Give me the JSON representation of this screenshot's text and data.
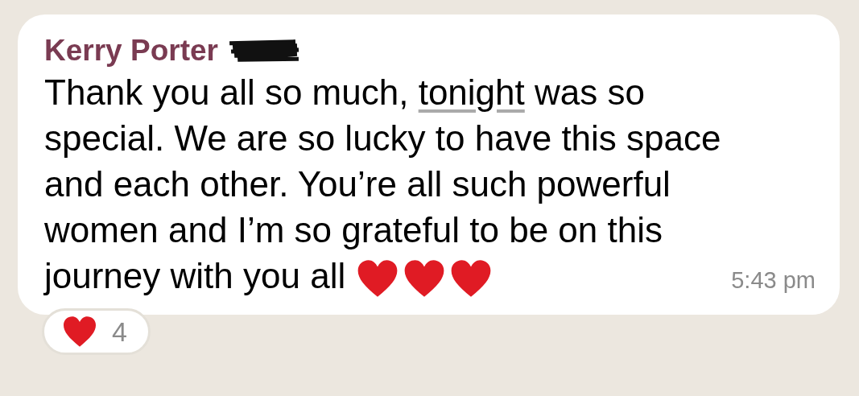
{
  "message": {
    "sender": "Kerry Porter",
    "sender_redacted": true,
    "text_before": "Thank you all so much, ",
    "link": "tonight",
    "text_after": " was so\nspecial. We are so lucky to have this space\nand each other. You’re all such powerful\nwomen and I’m so grateful to be on this\njourney with you all",
    "emoji": [
      {
        "kind": "heart"
      },
      {
        "kind": "heart"
      },
      {
        "kind": "heart"
      }
    ],
    "time": "5:43 pm"
  },
  "reaction": {
    "count": "4"
  }
}
